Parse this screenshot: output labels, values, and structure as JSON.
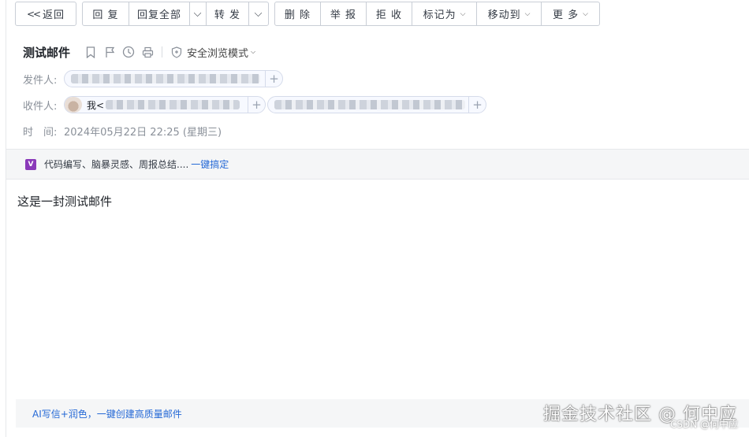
{
  "toolbar": {
    "back": "返回",
    "reply": "回 复",
    "reply_all": "回复全部",
    "forward": "转 发",
    "delete": "删 除",
    "report": "举 报",
    "reject": "拒 收",
    "mark_as": "标记为",
    "move_to": "移动到",
    "more": "更 多"
  },
  "email": {
    "subject": "测试邮件",
    "safe_mode": "安全浏览模式",
    "from_label": "发件人:",
    "to_label": "收件人:",
    "to_me": "我<",
    "time_label": "时　间:",
    "time_value": "2024年05月22日 22:25 (星期三)",
    "body": "这是一封测试邮件"
  },
  "promo": {
    "logo": "V",
    "text": "代码编写、脑暴灵感、周报总结.... ",
    "link": "一键搞定"
  },
  "ai_bar": {
    "link": "AI写信+润色，一键创建高质量邮件"
  },
  "watermark": {
    "big": "掘金技术社区 @ 何中应",
    "small": "CSDN @何中应"
  },
  "icons": [
    "chevron-double-left-icon",
    "bookmark-icon",
    "flag-icon",
    "clock-icon",
    "print-icon",
    "shield-icon",
    "chevron-down-icon",
    "plus-icon"
  ],
  "colors": {
    "link": "#2468d6",
    "border": "#c9ced6",
    "promo_bg": "#f5f6f7"
  }
}
